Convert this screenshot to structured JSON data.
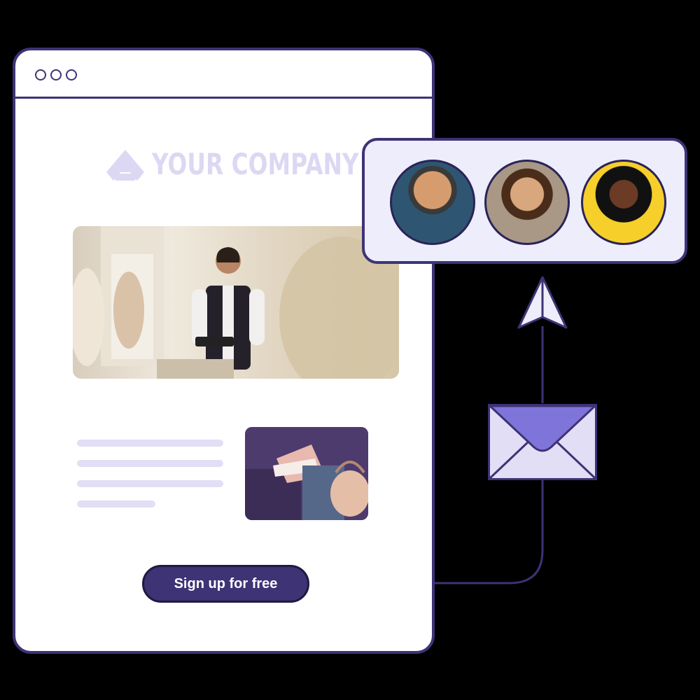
{
  "email": {
    "company_name": "YOUR COMPANY",
    "cta_label": "Sign up for free"
  },
  "icons": {
    "window_controls": [
      "circle-icon",
      "circle-icon",
      "circle-icon"
    ],
    "logo": "company-logo-icon",
    "envelope": "envelope-icon",
    "paper_plane": "paper-plane-icon"
  },
  "audience": {
    "avatars": [
      {
        "name": "avatar-man-glasses"
      },
      {
        "name": "avatar-woman-apron"
      },
      {
        "name": "avatar-woman-sunglasses"
      }
    ]
  },
  "colors": {
    "brand": "#3d3375",
    "accent": "#7f74d9",
    "light": "#e2def5"
  }
}
